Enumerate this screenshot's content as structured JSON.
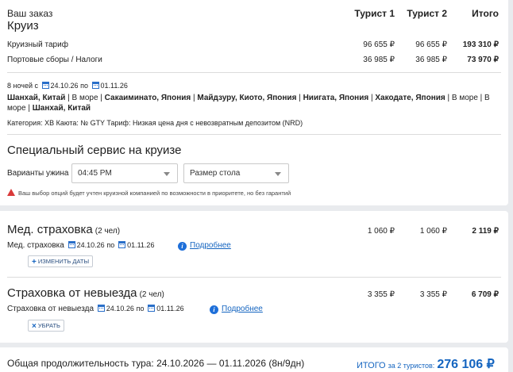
{
  "order": {
    "title": "Ваш заказ",
    "subtitle": "Круиз",
    "columns": [
      "Турист 1",
      "Турист 2",
      "Итого"
    ],
    "rows": [
      {
        "label": "Круизный тариф",
        "t1": "96 655 ₽",
        "t2": "96 655 ₽",
        "total": "193 310 ₽"
      },
      {
        "label": "Портовые сборы / Налоги",
        "t1": "36 985 ₽",
        "t2": "36 985 ₽",
        "total": "73 970 ₽"
      }
    ]
  },
  "cruise": {
    "nights_prefix": "8 ночей с",
    "date_from": "24.10.26",
    "to_word": "по",
    "date_to": "01.11.26",
    "route_line1": [
      {
        "text": "Шанхай, Китай",
        "bold": true
      },
      {
        "text": " | В море | ",
        "bold": false
      },
      {
        "text": "Сакаиминато, Япония",
        "bold": true
      },
      {
        "text": " | ",
        "bold": false
      },
      {
        "text": "Майдзуру, Киото, Япония",
        "bold": true
      },
      {
        "text": " | ",
        "bold": false
      },
      {
        "text": "Ниигата, Япония",
        "bold": true
      },
      {
        "text": " | ",
        "bold": false
      },
      {
        "text": "Хакодате, Япония",
        "bold": true
      },
      {
        "text": " | В море | В",
        "bold": false
      }
    ],
    "route_line2": [
      {
        "text": "море | ",
        "bold": false
      },
      {
        "text": "Шанхай, Китай",
        "bold": true
      }
    ],
    "category_line": "Категория: XB   Каюта: № GTY   Тариф: Низкая цена дня с невозвратным депозитом (NRD)"
  },
  "service": {
    "title": "Специальный сервис на круизе",
    "dinner_label": "Варианты ужина",
    "dinner_value": "04:45 PM",
    "table_value": "Размер стола",
    "warning": "Ваш выбор опций будет учтен круизной компанией по возможности в приоритете, но без гарантий"
  },
  "insurance_med": {
    "title": "Мед. страховка",
    "people": "(2 чел)",
    "t1": "1 060 ₽",
    "t2": "1 060 ₽",
    "total": "2 119 ₽",
    "sub_label": "Мед. страховка",
    "date_from": "24.10.26",
    "to_word": "по",
    "date_to": "01.11.26",
    "more_link": "Подробнее",
    "button": "ИЗМЕНИТЬ ДАТЫ"
  },
  "insurance_cancel": {
    "title": "Страховка от невыезда",
    "people": "(2 чел)",
    "t1": "3 355 ₽",
    "t2": "3 355 ₽",
    "total": "6 709 ₽",
    "sub_label": "Страховка от невыезда",
    "date_from": "24.10.26",
    "to_word": "по",
    "date_to": "01.11.26",
    "more_link": "Подробнее",
    "button": "УБРАТЬ"
  },
  "footer": {
    "duration": "Общая продолжительность тура: 24.10.2026 — 01.11.2026 (8н/9дн)",
    "total_label": "ИТОГО",
    "total_for": "за 2 туристов:",
    "total_value": "276 106 ₽"
  },
  "colors": {
    "accent": "#1565c0",
    "warning": "#d93a3a",
    "background": "#e9ebee"
  }
}
